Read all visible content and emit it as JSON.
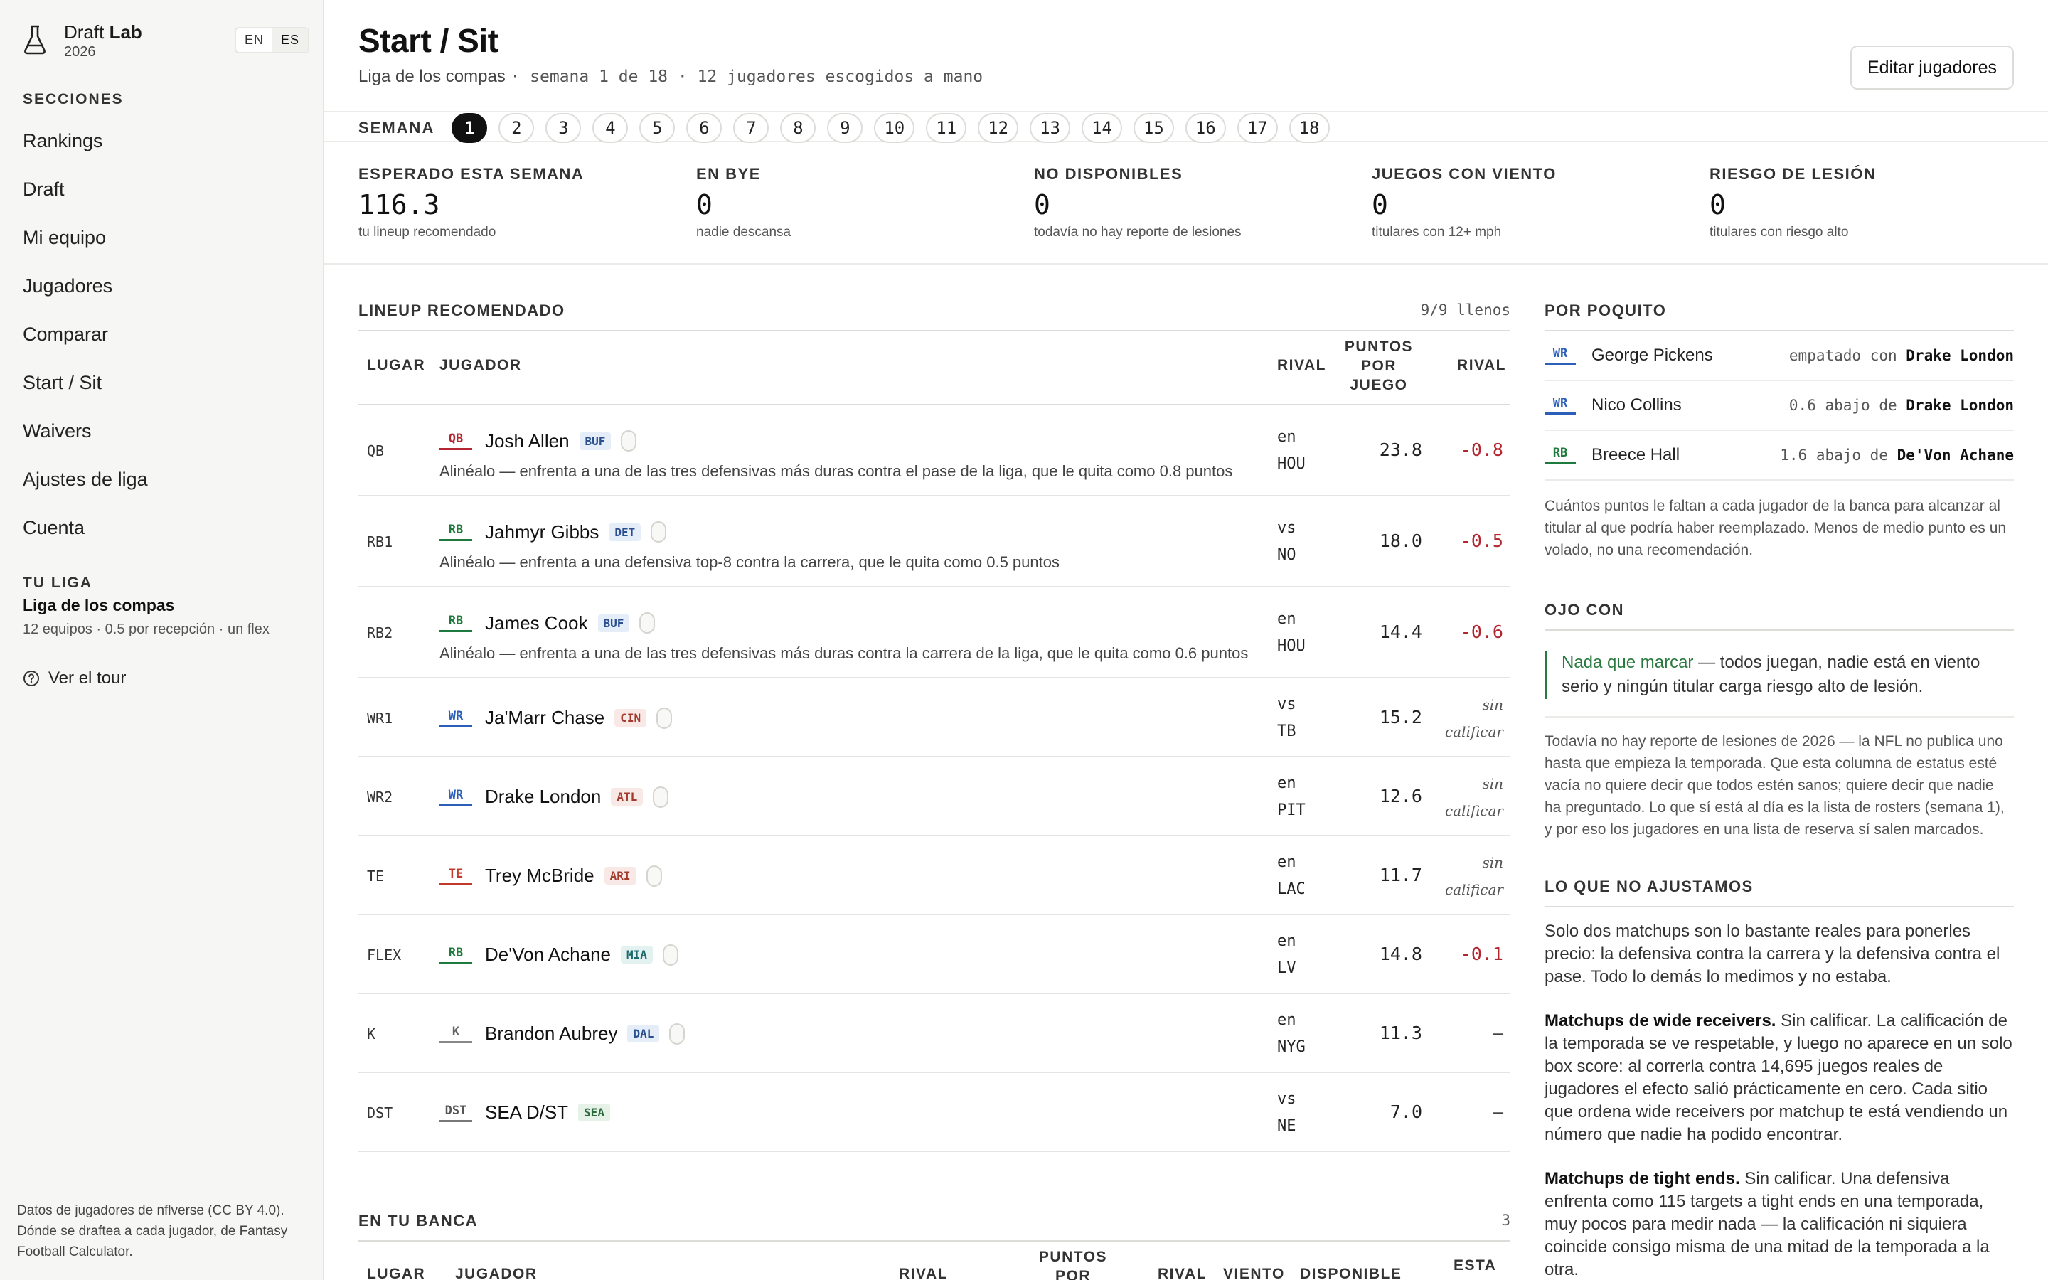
{
  "brand": {
    "name_plain": "Draft",
    "name_bold": "Lab",
    "year": "2026"
  },
  "lang": {
    "en": "EN",
    "es": "ES"
  },
  "sidebar": {
    "sections_title": "SECCIONES",
    "items": [
      {
        "label": "Rankings"
      },
      {
        "label": "Draft"
      },
      {
        "label": "Mi equipo"
      },
      {
        "label": "Jugadores"
      },
      {
        "label": "Comparar"
      },
      {
        "label": "Start / Sit"
      },
      {
        "label": "Waivers"
      },
      {
        "label": "Ajustes de liga"
      },
      {
        "label": "Cuenta"
      }
    ],
    "league_title": "TU LIGA",
    "league_name": "Liga de los compas",
    "league_sub": "12 equipos · 0.5 por recepción · un flex",
    "tour": "Ver el tour",
    "footnote": "Datos de jugadores de nflverse (CC BY 4.0). Dónde se draftea a cada jugador, de Fantasy Football Calculator."
  },
  "header": {
    "title": "Start / Sit",
    "league": "Liga de los compas",
    "meta": "· semana 1 de 18 · 12 jugadores escogidos a mano",
    "edit": "Editar jugadores"
  },
  "weeks": {
    "label": "SEMANA",
    "selected": "1",
    "list": [
      "1",
      "2",
      "3",
      "4",
      "5",
      "6",
      "7",
      "8",
      "9",
      "10",
      "11",
      "12",
      "13",
      "14",
      "15",
      "16",
      "17",
      "18"
    ]
  },
  "stats": [
    {
      "label": "ESPERADO ESTA SEMANA",
      "value": "116.3",
      "sub": "tu lineup recomendado"
    },
    {
      "label": "EN BYE",
      "value": "0",
      "sub": "nadie descansa"
    },
    {
      "label": "NO DISPONIBLES",
      "value": "0",
      "sub": "todavía no hay reporte de lesiones"
    },
    {
      "label": "JUEGOS CON VIENTO",
      "value": "0",
      "sub": "titulares con 12+ mph"
    },
    {
      "label": "RIESGO DE LESIÓN",
      "value": "0",
      "sub": "titulares con riesgo alto"
    }
  ],
  "lineup": {
    "title": "LINEUP RECOMENDADO",
    "count": "9/9 llenos",
    "headers": {
      "slot": "LUGAR",
      "player": "JUGADOR",
      "rival": "RIVAL",
      "ppg_1": "PUNTOS",
      "ppg_2": "POR",
      "ppg_3": "JUEGO",
      "adj": "RIVAL"
    },
    "rows": [
      {
        "slot": "QB",
        "pos": "QB",
        "name": "Josh Allen",
        "team": "BUF",
        "team_style": "blue",
        "rival_1": "en",
        "rival_2": "HOU",
        "ppg": "23.8",
        "adj": "-0.8",
        "adj_kind": "neg",
        "note": "Alinéalo — enfrenta a una de las tres defensivas más duras contra el pase de la liga, que le quita como 0.8 puntos"
      },
      {
        "slot": "RB1",
        "pos": "RB",
        "name": "Jahmyr Gibbs",
        "team": "DET",
        "team_style": "blue",
        "rival_1": "vs",
        "rival_2": "NO",
        "ppg": "18.0",
        "adj": "-0.5",
        "adj_kind": "neg",
        "note": "Alinéalo — enfrenta a una defensiva top-8 contra la carrera, que le quita como 0.5 puntos"
      },
      {
        "slot": "RB2",
        "pos": "RB",
        "name": "James Cook",
        "team": "BUF",
        "team_style": "blue",
        "rival_1": "en",
        "rival_2": "HOU",
        "ppg": "14.4",
        "adj": "-0.6",
        "adj_kind": "neg",
        "note": "Alinéalo — enfrenta a una de las tres defensivas más duras contra la carrera de la liga, que le quita como 0.6 puntos"
      },
      {
        "slot": "WR1",
        "pos": "WR",
        "name": "Ja'Marr Chase",
        "team": "CIN",
        "team_style": "red",
        "rival_1": "vs",
        "rival_2": "TB",
        "ppg": "15.2",
        "adj_1": "sin",
        "adj_2": "calificar",
        "adj_kind": "nr"
      },
      {
        "slot": "WR2",
        "pos": "WR",
        "name": "Drake London",
        "team": "ATL",
        "team_style": "red",
        "rival_1": "en",
        "rival_2": "PIT",
        "ppg": "12.6",
        "adj_1": "sin",
        "adj_2": "calificar",
        "adj_kind": "nr"
      },
      {
        "slot": "TE",
        "pos": "TE",
        "name": "Trey McBride",
        "team": "ARI",
        "team_style": "red",
        "rival_1": "en",
        "rival_2": "LAC",
        "ppg": "11.7",
        "adj_1": "sin",
        "adj_2": "calificar",
        "adj_kind": "nr"
      },
      {
        "slot": "FLEX",
        "pos": "RB",
        "name": "De'Von Achane",
        "team": "MIA",
        "team_style": "teal",
        "rival_1": "en",
        "rival_2": "LV",
        "ppg": "14.8",
        "adj": "-0.1",
        "adj_kind": "neg"
      },
      {
        "slot": "K",
        "pos": "K",
        "name": "Brandon Aubrey",
        "team": "DAL",
        "team_style": "blue",
        "rival_1": "en",
        "rival_2": "NYG",
        "ppg": "11.3",
        "adj": "—",
        "adj_kind": "dash"
      },
      {
        "slot": "DST",
        "pos": "DST",
        "name": "SEA D/ST",
        "team": "SEA",
        "team_style": "green",
        "rival_1": "vs",
        "rival_2": "NE",
        "ppg": "7.0",
        "adj": "—",
        "adj_kind": "dash"
      }
    ]
  },
  "bench": {
    "title": "EN TU BANCA",
    "count": "3",
    "headers": {
      "slot": "LUGAR",
      "player": "JUGADOR",
      "rival": "RIVAL",
      "ppg_1": "PUNTOS",
      "ppg_2": "POR",
      "adj": "RIVAL",
      "wind": "VIENTO",
      "avail": "DISPONIBLE",
      "esta": "ESTA"
    }
  },
  "close_calls": {
    "title": "POR POQUITO",
    "items": [
      {
        "pos": "WR",
        "name": "George Pickens",
        "text": "empatado con",
        "vs": "Drake London"
      },
      {
        "pos": "WR",
        "name": "Nico Collins",
        "text": "0.6 abajo de",
        "vs": "Drake London"
      },
      {
        "pos": "RB",
        "name": "Breece Hall",
        "text": "1.6 abajo de",
        "vs": "De'Von Achane"
      }
    ],
    "desc": "Cuántos puntos le faltan a cada jugador de la banca para alcanzar al titular al que podría haber reemplazado. Menos de medio punto es un volado, no una recomendación."
  },
  "watch": {
    "title": "OJO CON",
    "callout_green": "Nada que marcar",
    "callout_rest": " — todos juegan, nadie está en viento serio y ningún titular carga riesgo alto de lesión.",
    "desc": "Todavía no hay reporte de lesiones de 2026 — la NFL no publica uno hasta que empieza la temporada. Que esta columna de estatus esté vacía no quiere decir que todos estén sanos; quiere decir que nadie ha preguntado. Lo que sí está al día es la lista de rosters (semana 1), y por eso los jugadores en una lista de reserva sí salen marcados."
  },
  "no_adjust": {
    "title": "LO QUE NO AJUSTAMOS",
    "p1": "Solo dos matchups son lo bastante reales para ponerles precio: la defensiva contra la carrera y la defensiva contra el pase. Todo lo demás lo medimos y no estaba.",
    "p2_bold": "Matchups de wide receivers.",
    "p2": " Sin calificar. La calificación de la temporada se ve respetable, y luego no aparece en un solo box score: al correrla contra 14,695 juegos reales de jugadores el efecto salió prácticamente en cero. Cada sitio que ordena wide receivers por matchup te está vendiendo un número que nadie ha podido encontrar.",
    "p3_bold": "Matchups de tight ends.",
    "p3": " Sin calificar. Una defensiva enfrenta como 115 targets a tight ends en una temporada, muy pocos para medir nada — la calificación ni siquiera coincide consigo misma de una mitad de la temporada a la otra."
  },
  "colors": {
    "accent_green": "#2a7a3f",
    "negative_red": "#b3262f",
    "qb": "#b3262f",
    "rb": "#1f7a3d",
    "wr": "#2b5fb8",
    "te": "#c0392b"
  }
}
